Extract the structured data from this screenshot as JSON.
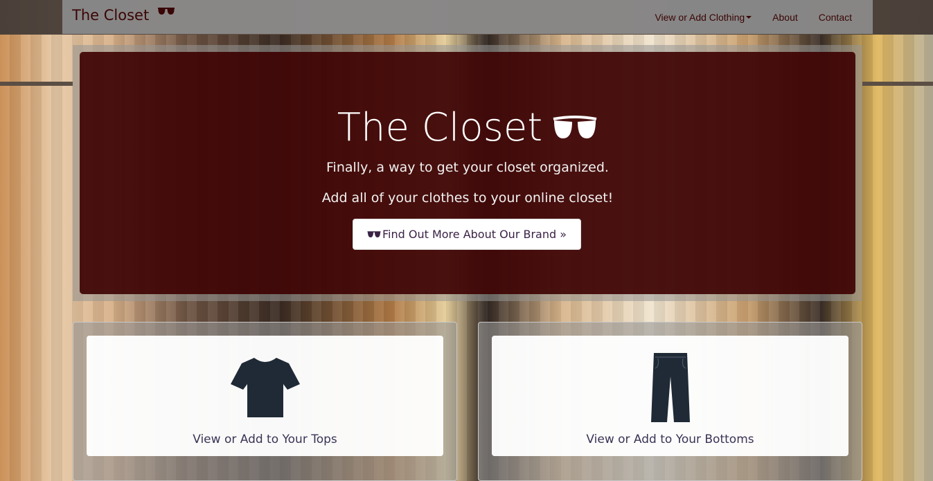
{
  "navbar": {
    "brand": "The Closet",
    "brand_icon": "sunglasses-icon",
    "links": [
      {
        "label": "View or Add Clothing",
        "dropdown": true
      },
      {
        "label": "About",
        "dropdown": false
      },
      {
        "label": "Contact",
        "dropdown": false
      }
    ]
  },
  "hero": {
    "title": "The Closet",
    "title_icon": "sunglasses-icon",
    "line1": "Finally, a way to get your closet organized.",
    "line2": "Add all of your clothes to your online closet!",
    "button_label": "Find Out More About Our Brand »",
    "button_icon": "sunglasses-icon"
  },
  "panels": [
    {
      "label": "View or Add to Your Tops",
      "icon": "tshirt-icon"
    },
    {
      "label": "View or Add to Your Bottoms",
      "icon": "pants-icon"
    }
  ],
  "colors": {
    "navbar_bg": "#8c8c8c",
    "brand_text": "#3a0505",
    "hero_bg": "#3c0000",
    "icon_dark": "#1f2a36"
  }
}
